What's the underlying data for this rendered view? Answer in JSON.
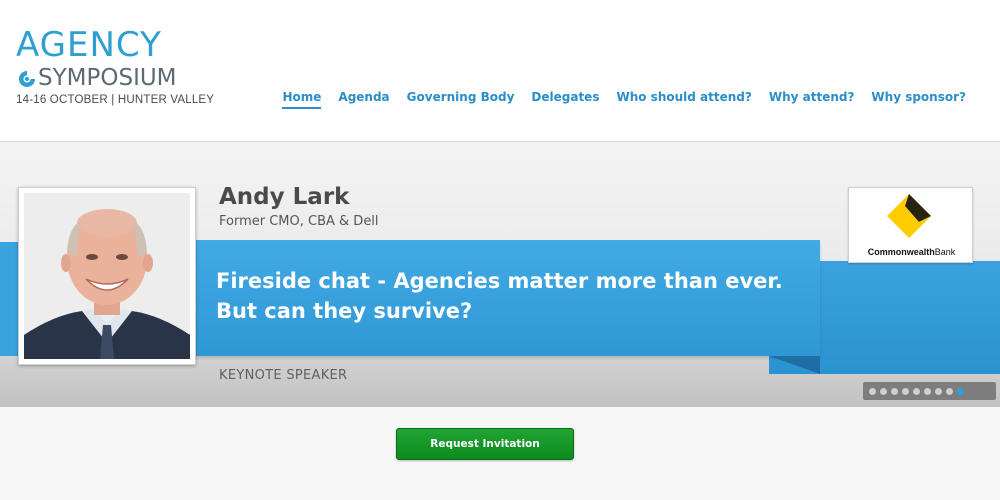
{
  "logo": {
    "line1": "AGENCY",
    "line2": "SYMPOSIUM",
    "line3": "14-16 OCTOBER | HUNTER VALLEY",
    "icon": "logo-swirl-icon"
  },
  "nav": {
    "items": [
      {
        "label": "Home",
        "active": true
      },
      {
        "label": "Agenda"
      },
      {
        "label": "Governing Body"
      },
      {
        "label": "Delegates"
      },
      {
        "label": "Who should attend?"
      },
      {
        "label": "Why attend?"
      },
      {
        "label": "Why sponsor?"
      }
    ]
  },
  "slide": {
    "speaker_name": "Andy Lark",
    "speaker_title": "Former CMO, CBA & Dell",
    "talk_title": "Fireside chat - Agencies matter more than ever. But can they survive?",
    "role": "KEYNOTE SPEAKER",
    "sponsor": {
      "name_bold": "Commonwealth",
      "name_regular": "Bank",
      "icon": "commonwealth-bank-logo-icon"
    }
  },
  "pager": {
    "count": 9,
    "active_index": 8
  },
  "cta": {
    "label": "Request Invitation"
  },
  "colors": {
    "brand_blue": "#2f9fd3",
    "nav_blue": "#2a8ec9",
    "ribbon_blue": "#3aa3df",
    "cta_green": "#1a9a2c"
  }
}
